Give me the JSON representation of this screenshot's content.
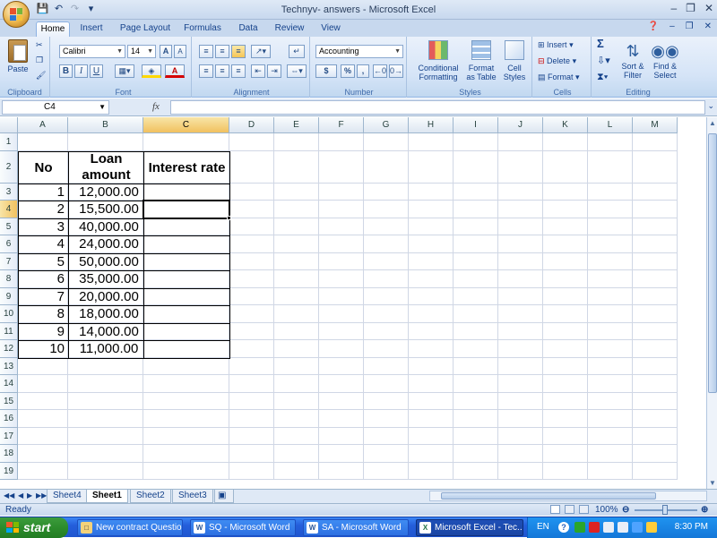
{
  "app": {
    "title": "Technyv- answers - Microsoft Excel",
    "qat": [
      "save-icon",
      "undo-icon",
      "redo-icon"
    ]
  },
  "tabs": [
    "Home",
    "Insert",
    "Page Layout",
    "Formulas",
    "Data",
    "Review",
    "View"
  ],
  "ribbon": {
    "clipboard": {
      "label": "Clipboard",
      "paste": "Paste"
    },
    "font": {
      "label": "Font",
      "name": "Calibri",
      "size": "14",
      "bold": "B",
      "italic": "I",
      "underline": "U",
      "grow": "A",
      "shrink": "A"
    },
    "alignment": {
      "label": "Alignment"
    },
    "number": {
      "label": "Number",
      "format": "Accounting",
      "currency": "$",
      "percent": "%",
      "comma": ","
    },
    "styles": {
      "label": "Styles",
      "conditional": "Conditional Formatting",
      "format_table": "Format as Table",
      "cell_styles": "Cell Styles"
    },
    "cells": {
      "label": "Cells",
      "insert": "Insert",
      "delete": "Delete",
      "format": "Format"
    },
    "editing": {
      "label": "Editing",
      "sort": "Sort & Filter",
      "find": "Find & Select",
      "sigma": "Σ"
    }
  },
  "formula_bar": {
    "name_box": "C4",
    "fx": "fx",
    "value": ""
  },
  "columns": [
    "A",
    "B",
    "C",
    "D",
    "E",
    "F",
    "G",
    "H",
    "I",
    "J",
    "K",
    "L",
    "M"
  ],
  "rows": [
    "1",
    "2",
    "3",
    "4",
    "5",
    "6",
    "7",
    "8",
    "9",
    "10",
    "11",
    "12",
    "13",
    "14",
    "15",
    "16",
    "17",
    "18",
    "19"
  ],
  "table": {
    "headers": {
      "no": "No",
      "loan": "Loan amount",
      "rate": "Interest rate"
    },
    "rows": [
      {
        "no": "1",
        "loan": "12,000.00"
      },
      {
        "no": "2",
        "loan": "15,500.00"
      },
      {
        "no": "3",
        "loan": "40,000.00"
      },
      {
        "no": "4",
        "loan": "24,000.00"
      },
      {
        "no": "5",
        "loan": "50,000.00"
      },
      {
        "no": "6",
        "loan": "35,000.00"
      },
      {
        "no": "7",
        "loan": "20,000.00"
      },
      {
        "no": "8",
        "loan": "18,000.00"
      },
      {
        "no": "9",
        "loan": "14,000.00"
      },
      {
        "no": "10",
        "loan": "11,000.00"
      }
    ]
  },
  "selected_cell": "C4",
  "sheets": [
    "Sheet4",
    "Sheet1",
    "Sheet2",
    "Sheet3"
  ],
  "active_sheet": "Sheet1",
  "status": {
    "ready": "Ready",
    "zoom": "100%"
  },
  "taskbar": {
    "start": "start",
    "tasks": [
      "New contract Questio...",
      "SQ - Microsoft Word",
      "SA - Microsoft Word",
      "Microsoft Excel - Tec..."
    ],
    "lang": "EN",
    "clock": "8:30 PM"
  },
  "colors": {
    "ribbon": "#d5e4f7",
    "selection": "#f1c15f",
    "taskbar": "#245edb",
    "start": "#2b8a2b"
  }
}
